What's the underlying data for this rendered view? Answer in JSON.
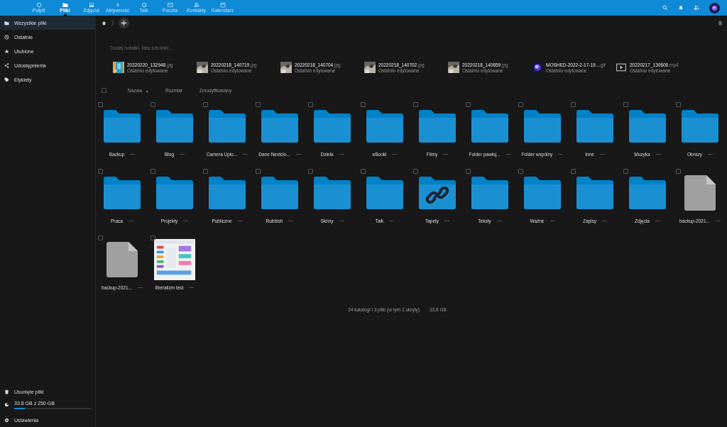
{
  "apps": [
    {
      "label": "Pulpit",
      "selected": false
    },
    {
      "label": "Pliki",
      "selected": true
    },
    {
      "label": "Zdjęcia",
      "selected": false
    },
    {
      "label": "Aktywność",
      "selected": false
    },
    {
      "label": "Talk",
      "selected": false
    },
    {
      "label": "Poczta",
      "selected": false
    },
    {
      "label": "Kontakty",
      "selected": false
    },
    {
      "label": "Kalendarz",
      "selected": false
    }
  ],
  "sidebar": {
    "items": [
      {
        "label": "Wszystkie pliki",
        "selected": true
      },
      {
        "label": "Ostatnie",
        "selected": false
      },
      {
        "label": "Ulubione",
        "selected": false
      },
      {
        "label": "Udostępnienia",
        "selected": false
      },
      {
        "label": "Etykiety",
        "selected": false
      }
    ],
    "trash": "Usunięte pliki",
    "quota": {
      "text": "33.8 GB z 250 GB",
      "level": 0.135
    },
    "settings": "Ustawienia"
  },
  "notes_placeholder": "Dodaj notatki, listy lub linki...",
  "recent": [
    {
      "name": "20220220_132948",
      "ext": ".jpg",
      "subtitle": "Ostatnio edytowane",
      "kind": "picture"
    },
    {
      "name": "20220218_140719",
      "ext": ".jpg",
      "subtitle": "Ostatnio edytowane",
      "kind": "picture"
    },
    {
      "name": "20220218_140704",
      "ext": ".jpg",
      "subtitle": "Ostatnio edytowane",
      "kind": "picture"
    },
    {
      "name": "20220218_140702",
      "ext": ".jpg",
      "subtitle": "Ostatnio edytowane",
      "kind": "picture"
    },
    {
      "name": "20220218_140659",
      "ext": ".jpg",
      "subtitle": "Ostatnio edytowane",
      "kind": "picture"
    },
    {
      "name": "MOSHED-2022-2-17-19....",
      "ext": "gif",
      "subtitle": "Ostatnio edytowane",
      "kind": "picture"
    },
    {
      "name": "20220217_130606",
      "ext": ".mp4",
      "subtitle": "Ostatnio edytowane",
      "kind": "video"
    }
  ],
  "select_all": {
    "checked": false
  },
  "columns": [
    {
      "label": "Nazwa",
      "sort": "▴"
    },
    {
      "label": "Rozmiar"
    },
    {
      "label": "Zmodyfikowany"
    }
  ],
  "files": [
    {
      "name": "Backup",
      "kind": "folder",
      "checked": false
    },
    {
      "name": "Blog",
      "kind": "folder",
      "checked": false
    },
    {
      "name": "Camera Uplo...",
      "kind": "folder",
      "checked": false
    },
    {
      "name": "Dane Nextclo...",
      "kind": "folder",
      "checked": false
    },
    {
      "name": "Dzieła",
      "kind": "folder",
      "checked": false
    },
    {
      "name": "eBooki",
      "kind": "folder",
      "checked": false
    },
    {
      "name": "Filmy",
      "kind": "folder",
      "checked": false
    },
    {
      "name": "Folder pawłoj...",
      "kind": "folder",
      "checked": false
    },
    {
      "name": "Folder wspólny",
      "kind": "folder",
      "checked": false
    },
    {
      "name": "Inne",
      "kind": "folder",
      "checked": false
    },
    {
      "name": "Muzyka",
      "kind": "folder",
      "checked": false
    },
    {
      "name": "Obrazy",
      "kind": "folder",
      "checked": false
    },
    {
      "name": "Praca",
      "kind": "folder",
      "checked": false
    },
    {
      "name": "Projekty",
      "kind": "folder",
      "checked": false
    },
    {
      "name": "Publiczne",
      "kind": "folder",
      "checked": false
    },
    {
      "name": "Rubbish",
      "kind": "folder",
      "checked": false
    },
    {
      "name": "Skriny",
      "kind": "folder",
      "checked": false
    },
    {
      "name": "Talk",
      "kind": "folder",
      "checked": false
    },
    {
      "name": "Tapety",
      "kind": "linked-folder",
      "checked": false
    },
    {
      "name": "Teksty",
      "kind": "folder",
      "checked": false
    },
    {
      "name": "Ważne",
      "kind": "folder",
      "checked": false
    },
    {
      "name": "Zapisy",
      "kind": "folder",
      "checked": false
    },
    {
      "name": "Zdjęcia",
      "kind": "folder",
      "checked": false
    },
    {
      "name": "backup-2021...",
      "kind": "file",
      "checked": false
    },
    {
      "name": "backup-2021...",
      "kind": "file",
      "checked": false
    },
    {
      "name": "liberalizm test",
      "kind": "picture",
      "checked": false
    }
  ],
  "summary": {
    "counts": "24 katalogi i 3 pliki (w tym 1 ukryty)",
    "size": "33,8 GB"
  }
}
